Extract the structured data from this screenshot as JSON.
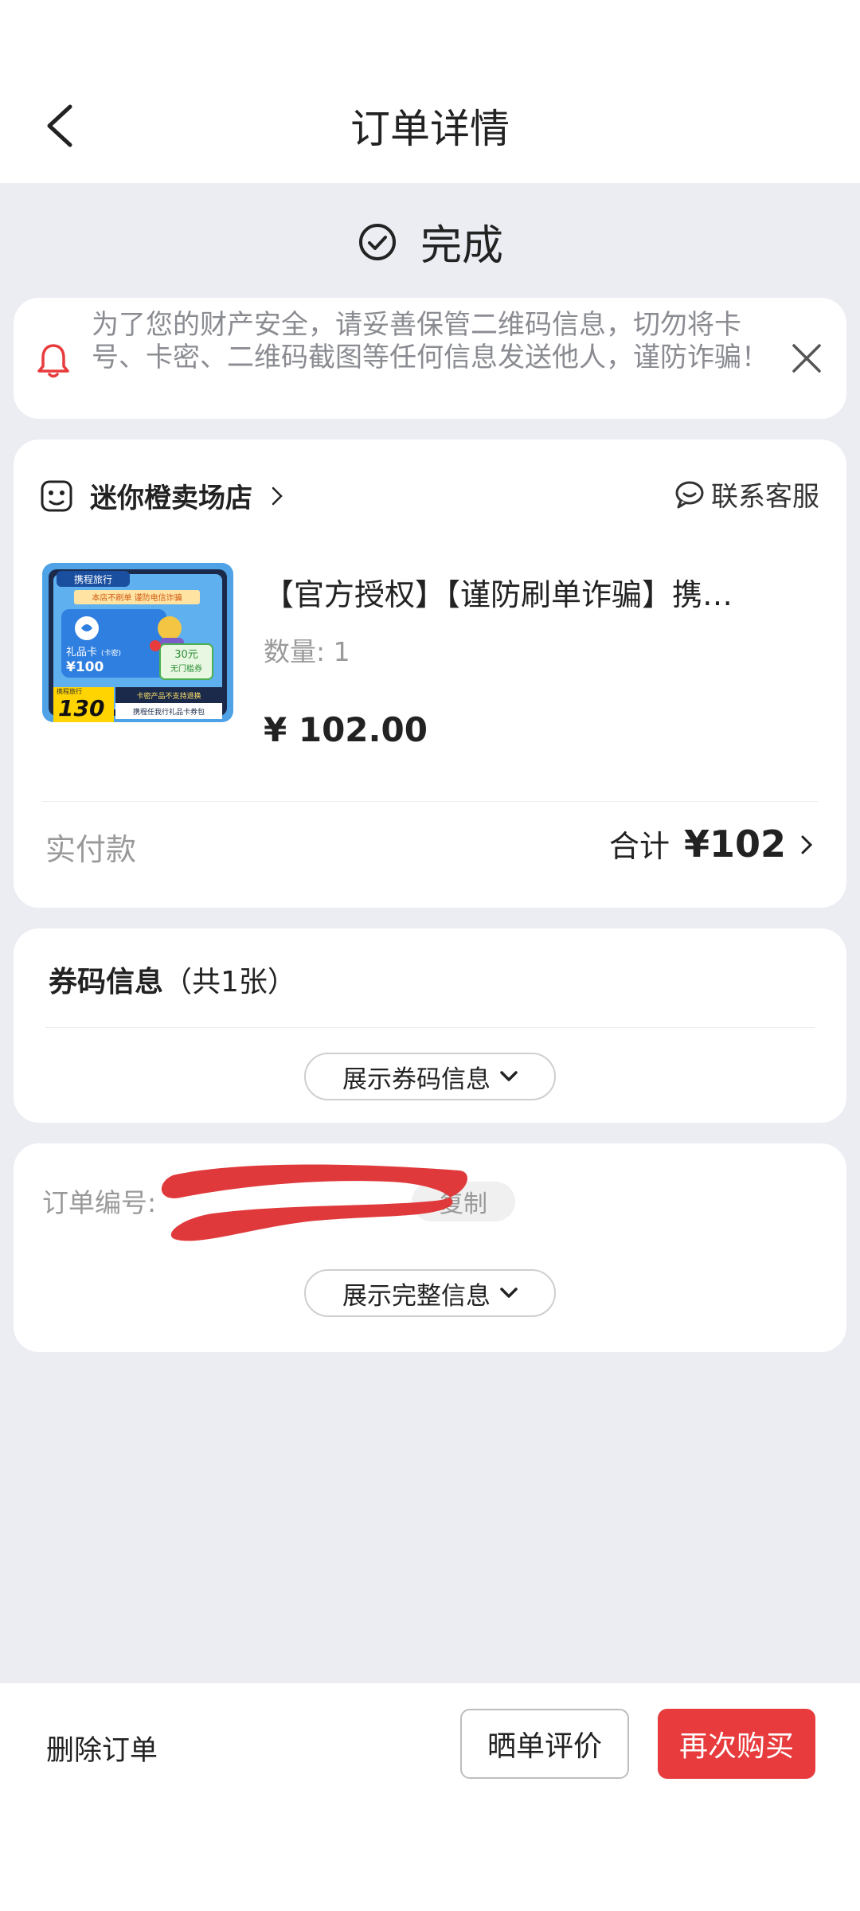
{
  "header": {
    "title": "订单详情"
  },
  "status": {
    "text": "完成"
  },
  "notice": {
    "text": "为了您的财产安全，请妥善保管二维码信息，切勿将卡号、卡密、二维码截图等任何信息发送他人，谨防诈骗！"
  },
  "store": {
    "name": "迷你橙卖场店",
    "service_label": "联系客服",
    "product": {
      "title": "【官方授权】【谨防刷单诈骗】携…",
      "quantity": "数量: 1",
      "price": "¥ 102.00",
      "image_texts": {
        "brand": "携程旅行",
        "banner": "本店不刷单 谨防电信诈骗",
        "card": "礼品卡",
        "card_sub": "(卡密)",
        "card_value": "¥100",
        "coupon_value": "30元",
        "coupon_desc": "无门槛券",
        "badge_top": "携程旅行",
        "price_130": "130",
        "warn1": "卡密产品不支持退换",
        "warn2": "携程任我行礼品卡券包"
      }
    },
    "paid_label": "实付款",
    "total_label": "合计",
    "total_value": "¥102"
  },
  "coupon": {
    "title_bold": "券码信息",
    "title_count": "（共1张）",
    "toggle_label": "展示券码信息"
  },
  "order": {
    "number_label": "订单编号:",
    "copy_label": "复制",
    "toggle_label": "展示完整信息"
  },
  "bottom": {
    "delete_label": "删除订单",
    "review_label": "晒单评价",
    "buy_again_label": "再次购买"
  },
  "colors": {
    "accent_red": "#e83b3d",
    "background": "#ebedf2",
    "redaction": "#e0393b"
  }
}
